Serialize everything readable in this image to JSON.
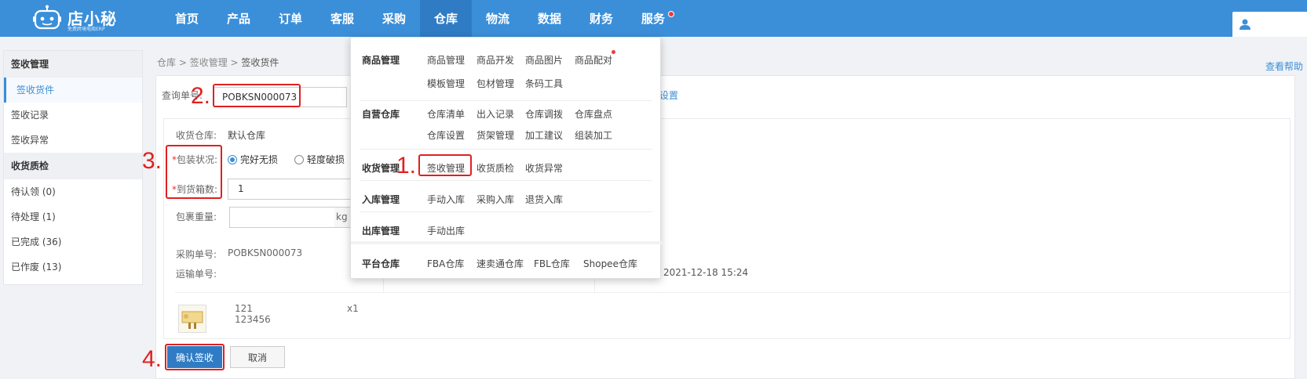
{
  "app": {
    "logo_text": "店小秘",
    "logo_sub": "免费跨境电商ERP"
  },
  "nav": {
    "items": [
      {
        "label": "首页"
      },
      {
        "label": "产品"
      },
      {
        "label": "订单"
      },
      {
        "label": "客服"
      },
      {
        "label": "采购"
      },
      {
        "label": "仓库",
        "active": true
      },
      {
        "label": "物流"
      },
      {
        "label": "数据"
      },
      {
        "label": "财务"
      },
      {
        "label": "服务",
        "badge": true
      }
    ]
  },
  "sidebar": {
    "group1": "签收管理",
    "items1": [
      "签收货件",
      "签收记录",
      "签收异常"
    ],
    "group2": "收货质检",
    "items2": [
      "待认领 (0)",
      "待处理 (1)",
      "已完成 (36)",
      "已作废 (13)"
    ]
  },
  "breadcrumb": {
    "part1": "仓库",
    "sep": " > ",
    "part2": "签收管理",
    "current": "签收货件"
  },
  "help_link": "查看帮助",
  "form": {
    "query_label": "查询单号:",
    "query_value": "POBKSN000073",
    "settings_link": "设置",
    "warehouse_label": "收货仓库:",
    "warehouse_value": "默认仓库",
    "package_label": "包装状况:",
    "radio_good": "完好无损",
    "radio_damaged": "轻度破损",
    "boxes_label": "到货箱数:",
    "boxes_value": "1",
    "weight_label": "包裹重量:",
    "weight_unit": "kg",
    "po_label": "采购单号:",
    "po_value": "POBKSN000073",
    "ship_label": "运输单号:",
    "ship_value": "",
    "date_value": "2021-12-18 15:24",
    "item_name": "121",
    "item_sku": "123456",
    "item_qty": "x1",
    "confirm_button": "确认签收",
    "cancel_button": "取消"
  },
  "dropdown": {
    "sections": [
      {
        "title": "商品管理",
        "row1": [
          "商品管理",
          "商品开发",
          "商品图片",
          "商品配对"
        ],
        "row2": [
          "模板管理",
          "包材管理",
          "条码工具"
        ]
      },
      {
        "title": "自营仓库",
        "row1": [
          "仓库清单",
          "出入记录",
          "仓库调拨",
          "仓库盘点"
        ],
        "row2": [
          "仓库设置",
          "货架管理",
          "加工建议",
          "组装加工"
        ]
      },
      {
        "title": "收货管理",
        "row1": [
          "签收管理",
          "收货质检",
          "收货异常"
        ]
      },
      {
        "title": "入库管理",
        "row1": [
          "手动入库",
          "采购入库",
          "退货入库"
        ]
      },
      {
        "title": "出库管理",
        "row1": [
          "手动出库"
        ]
      },
      {
        "title": "平台仓库",
        "row1": [
          "FBA仓库",
          "速卖通仓库",
          "FBL仓库",
          "Shopee仓库"
        ]
      }
    ]
  },
  "annotations": {
    "n1": "1.",
    "n2": "2.",
    "n3": "3.",
    "n4": "4."
  },
  "colors": {
    "topbar": "#3b8fd9",
    "accent": "#2f7cc4",
    "annotation": "#e02020"
  }
}
